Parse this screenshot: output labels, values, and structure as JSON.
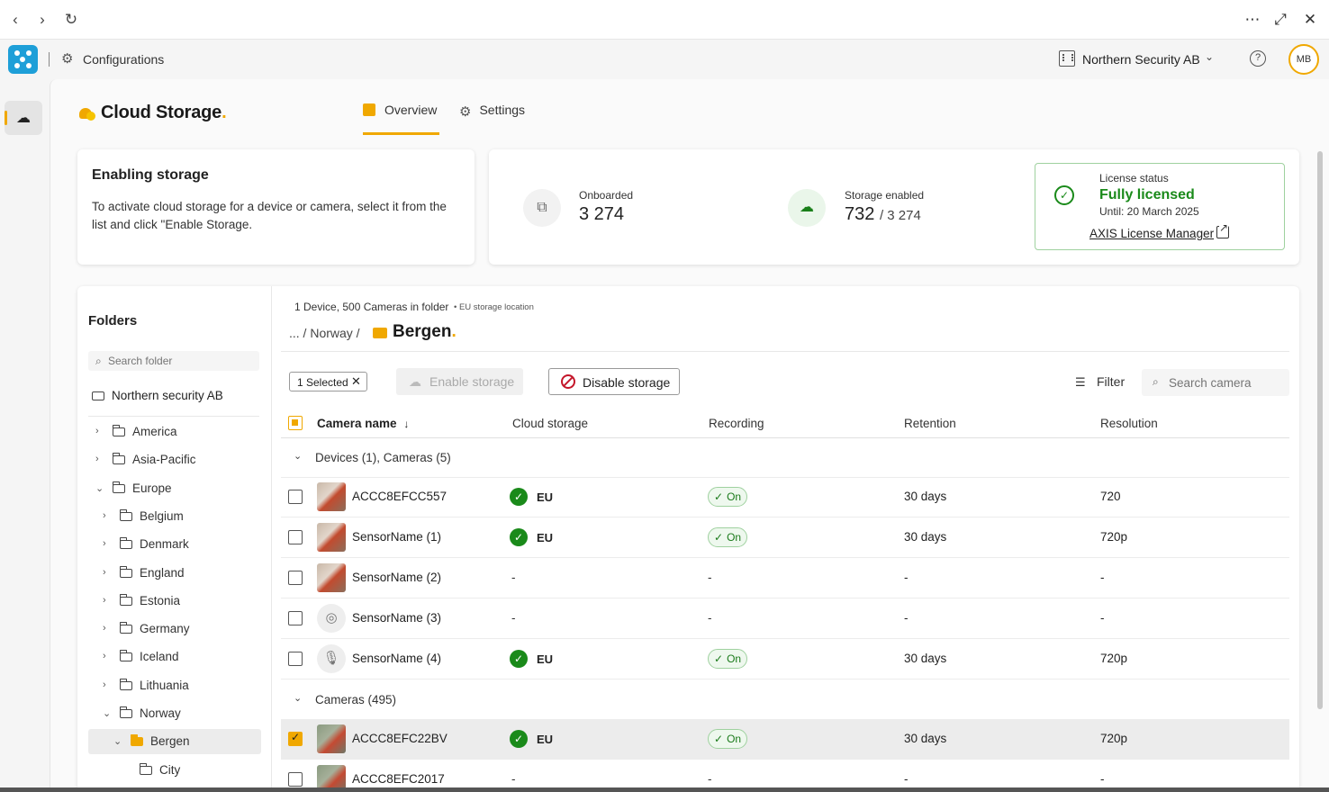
{
  "app": {
    "section": "Configurations",
    "organization": "Northern Security AB",
    "user_initials": "MB",
    "help_glyph": "?",
    "product_title": "Cloud Storage",
    "product_dot": "."
  },
  "tabs": [
    {
      "label": "Overview",
      "active": true
    },
    {
      "label": "Settings",
      "active": false
    }
  ],
  "info_card": {
    "title": "Enabling storage",
    "text": "To activate cloud storage for a device or camera, select it from the list and click \"Enable Storage."
  },
  "stats": {
    "onboarded_label": "Onboarded",
    "onboarded_value": "3 274",
    "storage_label": "Storage enabled",
    "storage_value": "732",
    "storage_total": "/ 3 274"
  },
  "license": {
    "label": "License status",
    "status": "Fully licensed",
    "until": "Until: 20 March 2025",
    "link": "AXIS License Manager"
  },
  "folders": {
    "title": "Folders",
    "search_placeholder": "Search folder",
    "root": "Northern security AB",
    "items": [
      {
        "label": "America",
        "level": 0,
        "expanded": false
      },
      {
        "label": "Asia-Pacific",
        "level": 0,
        "expanded": false
      },
      {
        "label": "Europe",
        "level": 0,
        "expanded": true
      },
      {
        "label": "Belgium",
        "level": 1,
        "expanded": false
      },
      {
        "label": "Denmark",
        "level": 1,
        "expanded": false
      },
      {
        "label": "England",
        "level": 1,
        "expanded": false
      },
      {
        "label": "Estonia",
        "level": 1,
        "expanded": false
      },
      {
        "label": "Germany",
        "level": 1,
        "expanded": false
      },
      {
        "label": "Iceland",
        "level": 1,
        "expanded": false
      },
      {
        "label": "Lithuania",
        "level": 1,
        "expanded": false
      },
      {
        "label": "Norway",
        "level": 1,
        "expanded": true
      },
      {
        "label": "Bergen",
        "level": 2,
        "expanded": true,
        "selected": true
      },
      {
        "label": "City",
        "level": 3,
        "expanded": false
      }
    ]
  },
  "content": {
    "folder_info": "1 Device, 500 Cameras in folder",
    "location": "EU storage location",
    "breadcrumb_parent": "... /  Norway  /",
    "breadcrumb_current": "Bergen",
    "selected_label": "1 Selected",
    "enable_label": "Enable storage",
    "disable_label": "Disable storage",
    "filter_label": "Filter",
    "search_placeholder": "Search camera",
    "columns": [
      "Camera name",
      "Cloud storage",
      "Recording",
      "Retention",
      "Resolution"
    ],
    "group1": "Devices (1), Cameras (5)",
    "group2": "Cameras (495)",
    "rows": [
      {
        "name": "ACCC8EFCC557",
        "cloud": "EU",
        "recording": "On",
        "retention": "30 days",
        "resolution": "720",
        "thumb": "photo",
        "checked": false
      },
      {
        "name": "SensorName (1)",
        "cloud": "EU",
        "recording": "On",
        "retention": "30 days",
        "resolution": "720p",
        "thumb": "photo",
        "checked": false
      },
      {
        "name": "SensorName (2)",
        "cloud": "-",
        "recording": "-",
        "retention": "-",
        "resolution": "-",
        "thumb": "photo",
        "checked": false
      },
      {
        "name": "SensorName (3)",
        "cloud": "-",
        "recording": "-",
        "retention": "-",
        "resolution": "-",
        "thumb": "radar",
        "checked": false
      },
      {
        "name": "SensorName (4)",
        "cloud": "EU",
        "recording": "On",
        "retention": "30 days",
        "resolution": "720p",
        "thumb": "mic",
        "checked": false
      },
      {
        "name": "ACCC8EFC22BV",
        "cloud": "EU",
        "recording": "On",
        "retention": "30 days",
        "resolution": "720p",
        "thumb": "green",
        "checked": true
      },
      {
        "name": "ACCC8EFC2017",
        "cloud": "-",
        "recording": "-",
        "retention": "-",
        "resolution": "-",
        "thumb": "green",
        "checked": false
      }
    ]
  },
  "icons": {
    "check": "✓",
    "close": "✕",
    "chevron_down": "⌄",
    "sort_arrow": "↓",
    "recording_check": "✓"
  },
  "colors": {
    "accent": "#f0a800",
    "success": "#1a8a1a",
    "danger": "#c4162a",
    "brand_logo": "#1e9fd8"
  }
}
